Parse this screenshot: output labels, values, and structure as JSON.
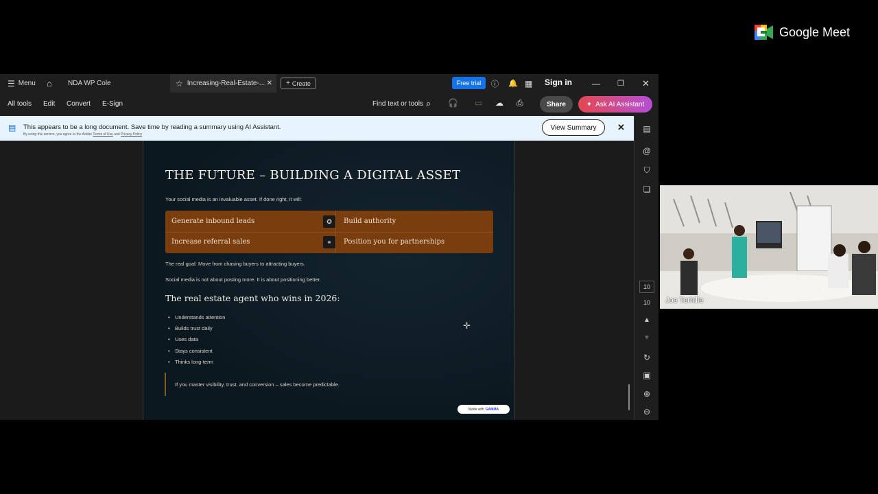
{
  "tabbar": {
    "menu_label": "Menu",
    "tabs": [
      {
        "label": "NDA WP Cole"
      },
      {
        "label": "Increasing-Real-Estate-..."
      }
    ],
    "create_label": "Create",
    "free_trial_label": "Free trial",
    "sign_in_label": "Sign in"
  },
  "toolbar": {
    "items": [
      "All tools",
      "Edit",
      "Convert",
      "E-Sign"
    ],
    "find_label": "Find text or tools",
    "share_label": "Share",
    "ai_label": "Ask AI Assistant"
  },
  "banner": {
    "text": "This appears to be a long document. Save time by reading a summary using AI Assistant.",
    "sub_prefix": "By using this service, you agree to the Adobe",
    "terms_link": "Terms of Use",
    "and_text": "and",
    "privacy_link": "Privacy Policy",
    "view_summary_label": "View Summary",
    "close_glyph": "✕"
  },
  "slide": {
    "title": "THE FUTURE – BUILDING A DIGITAL ASSET",
    "intro": "Your social media is an invaluable asset. If done right, it will:",
    "table": {
      "row1_left": "Generate inbound leads",
      "row1_right": "Build authority",
      "row2_left": "Increase referral sales",
      "row2_right": "Position you for partnerships"
    },
    "goal": "The real goal: Move from chasing buyers to attracting buyers.",
    "positioning": "Social media is not about posting more. It is about positioning better.",
    "subheading": "The real estate agent who wins in 2026:",
    "bullets": [
      "Understands attention",
      "Builds trust daily",
      "Uses data",
      "Stays consistent",
      "Thinks long-term"
    ],
    "quote": "If you master visibility, trust, and conversion – sales become predictable.",
    "badge_prefix": "Made with",
    "badge_brand": "GAMMA"
  },
  "rail": {
    "page_current": "10",
    "page_total": "10"
  },
  "meet": {
    "app_name": "Google Meet",
    "participant_name": "Joe Terhille"
  },
  "colors": {
    "accent_blue": "#1473e6",
    "slide_bg": "#0e1b24",
    "table_brown": "#7a3d0d",
    "banner_bg": "#e8f4fd"
  }
}
